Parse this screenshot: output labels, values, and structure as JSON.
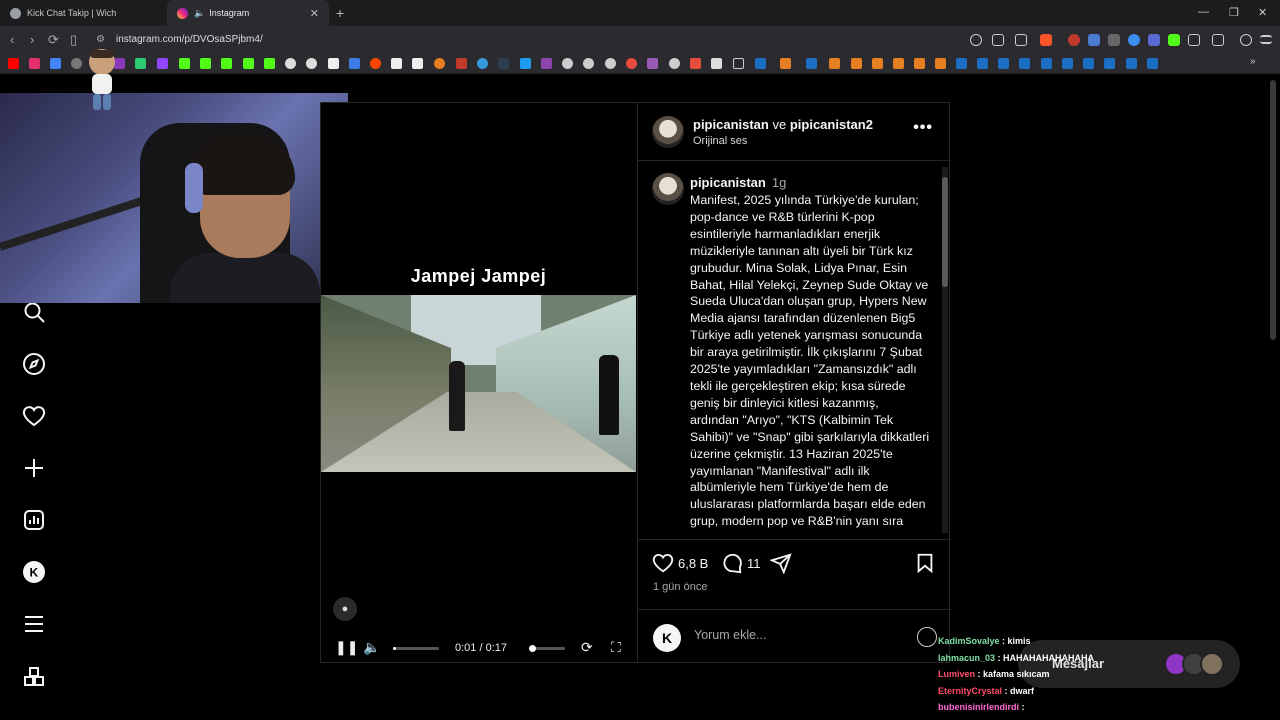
{
  "browser": {
    "tabs": [
      {
        "title": "Kick Chat Takip | Wich",
        "active": false
      },
      {
        "title": "Instagram",
        "active": true
      }
    ],
    "url": "instagram.com/p/DVOsaSPjbm4/"
  },
  "colors": {
    "instagram_bg": "#000000",
    "secondary_text": "#a8a8a8",
    "border": "#262626",
    "bookmark_steam": "#1b6ec2",
    "bookmark_kick": "#53fc18"
  },
  "sidebar_icons": [
    "search-icon",
    "explore-icon",
    "heart-icon",
    "create-icon",
    "dashboard-icon",
    "kick-icon",
    "menu-icon",
    "apps-icon"
  ],
  "video": {
    "title": "Jampej Jampej",
    "time": "0:01 / 0:17",
    "progress": 0.06
  },
  "post": {
    "header_user1": "pipicanistan",
    "header_joiner": "ve",
    "header_user2": "pipicanistan2",
    "audio": "Orijinal ses",
    "caption_user": "pipicanistan",
    "caption_time": "1g",
    "caption": "Manifest, 2025 yılında Türkiye'de kurulan; pop-dance ve R&B türlerini K-pop esintileriyle harmanladıkları enerjik müzikleriyle tanınan altı üyeli bir Türk kız grubudur. Mina Solak, Lidya Pınar, Esin Bahat, Hilal Yelekçi, Zeynep Sude Oktay ve Sueda Uluca'dan oluşan grup, Hypers New Media ajansı tarafından düzenlenen Big5 Türkiye adlı yetenek yarışması sonucunda bir araya getirilmiştir. İlk çıkışlarını 7 Şubat 2025'te yayımladıkları \"Zamansızdık\" adlı tekli ile gerçekleştiren ekip; kısa sürede geniş bir dinleyici kitlesi kazanmış, ardından \"Arıyo\", \"KTS (Kalbimin Tek Sahibi)\" ve \"Snap\" gibi şarkılarıyla dikkatleri üzerine çekmiştir. 13 Haziran 2025'te yayımlanan \"Manifestival\" adlı ilk albümleriyle hem Türkiye'de hem de uluslararası platformlarda başarı elde eden grup, modern pop ve R&B'nin yanı sıra",
    "likes": "6,8 B",
    "comments": "11",
    "date": "1 gün önce",
    "comment_placeholder": "Yorum ekle..."
  },
  "chat": [
    {
      "user": "KadimSovalye",
      "color": "#7fe0a8",
      "msg": ": kimis"
    },
    {
      "user": "lahmacun_03",
      "color": "#7fe0a8",
      "msg": ": HAHAHAHAHAHAHA"
    },
    {
      "user": "Lumiven",
      "color": "#ff4d6a",
      "msg": ": kafama sıkıcam"
    },
    {
      "user": "EternityCrystal",
      "color": "#ff4d6a",
      "msg": ": dwarf"
    },
    {
      "user": "bubenisinirlendirdi",
      "color": "#ff6ad5",
      "msg": ":"
    }
  ],
  "messages": {
    "label": "Mesajlar"
  }
}
